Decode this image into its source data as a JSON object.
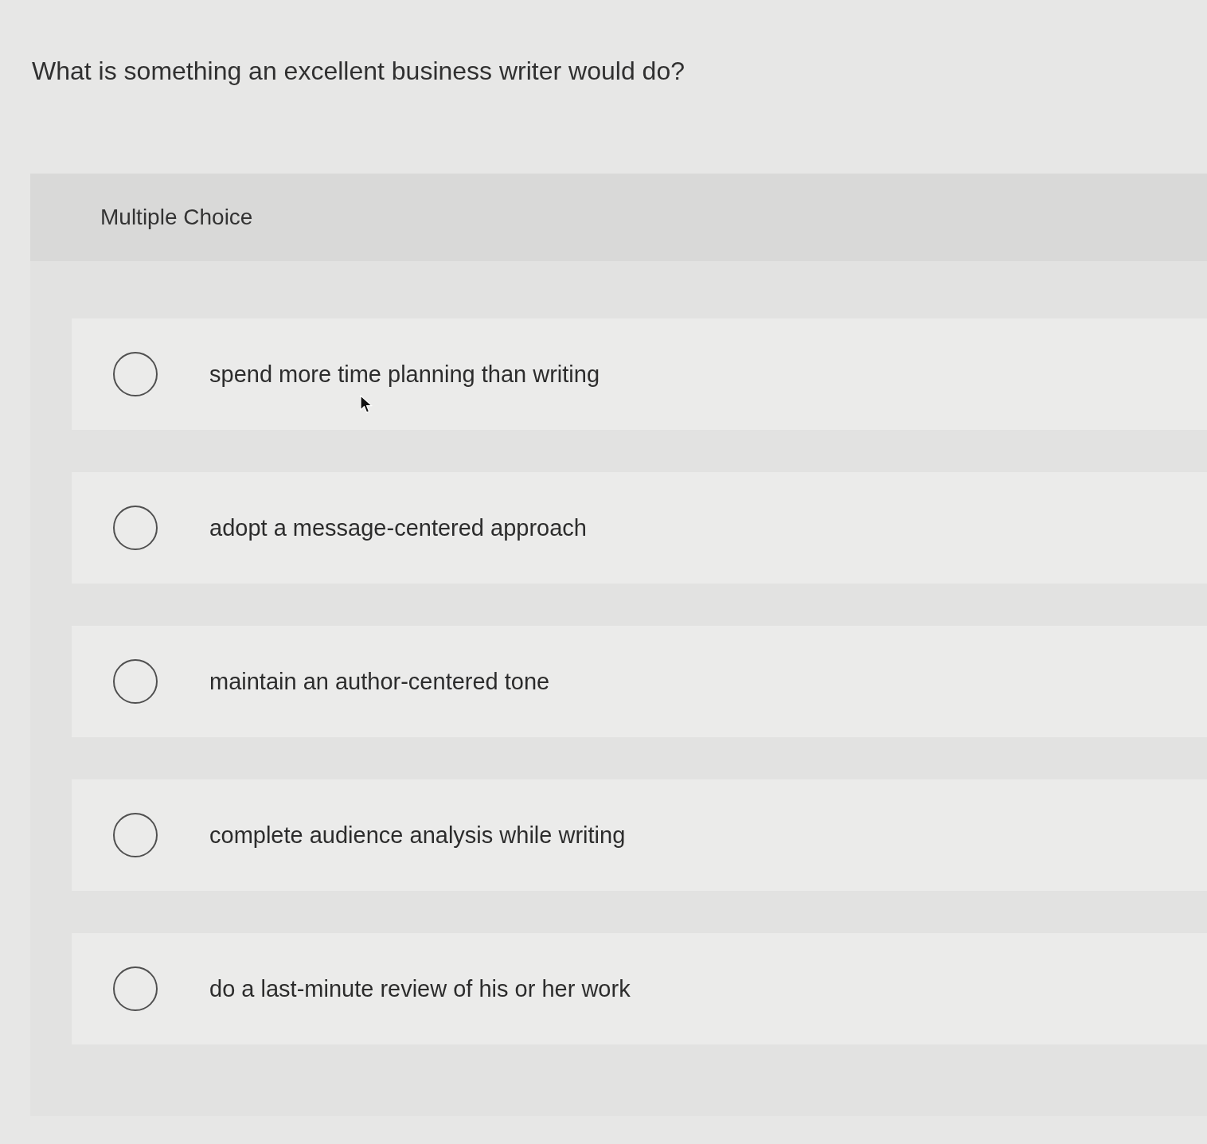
{
  "question": {
    "text": "What is something an excellent business writer would do?"
  },
  "panel": {
    "type_label": "Multiple Choice",
    "options": [
      {
        "label": "spend more time planning than writing",
        "selected": false
      },
      {
        "label": "adopt a message-centered approach",
        "selected": false
      },
      {
        "label": "maintain an author-centered tone",
        "selected": false
      },
      {
        "label": "complete audience analysis while writing",
        "selected": false
      },
      {
        "label": "do a last-minute review of his or her work",
        "selected": false
      }
    ]
  }
}
